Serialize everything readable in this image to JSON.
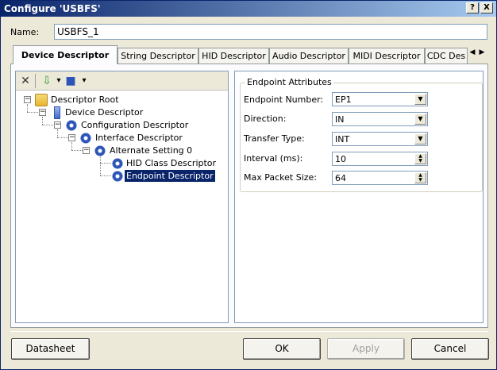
{
  "window": {
    "title": "Configure 'USBFS'",
    "help_glyph": "?",
    "close_glyph": "X"
  },
  "name_field": {
    "label": "Name:",
    "value": "USBFS_1"
  },
  "tabs": [
    {
      "label": "Device Descriptor",
      "active": true
    },
    {
      "label": "String Descriptor"
    },
    {
      "label": "HID Descriptor"
    },
    {
      "label": "Audio Descriptor"
    },
    {
      "label": "MIDI Descriptor"
    },
    {
      "label": "CDC Des"
    }
  ],
  "tab_scroll": {
    "left": "◀",
    "right": "▶"
  },
  "tree_toolbar": {
    "delete_glyph": "✕",
    "import_glyph": "⇩",
    "save_glyph": "■",
    "dropdown_glyph": "▾"
  },
  "tree": [
    {
      "label": "Descriptor Root",
      "expander": "−"
    },
    {
      "label": "Device Descriptor",
      "expander": "−"
    },
    {
      "label": "Configuration Descriptor",
      "expander": "−"
    },
    {
      "label": "Interface Descriptor",
      "expander": "−"
    },
    {
      "label": "Alternate Setting 0",
      "expander": "−"
    },
    {
      "label": "HID Class Descriptor"
    },
    {
      "label": "Endpoint Descriptor",
      "selected": true
    }
  ],
  "endpoint": {
    "group_title": "Endpoint Attributes",
    "fields": [
      {
        "label": "Endpoint Number:",
        "value": "EP1",
        "control": "combo"
      },
      {
        "label": "Direction:",
        "value": "IN",
        "control": "combo"
      },
      {
        "label": "Transfer Type:",
        "value": "INT",
        "control": "combo"
      },
      {
        "label": "Interval (ms):",
        "value": "10",
        "control": "spin"
      },
      {
        "label": "Max Packet Size:",
        "value": "64",
        "control": "spin"
      }
    ]
  },
  "buttons": {
    "datasheet": "Datasheet",
    "ok": "OK",
    "apply": "Apply",
    "cancel": "Cancel"
  },
  "colors": {
    "title_start": "#0a246a",
    "title_end": "#a6caf0",
    "selection": "#0a246a",
    "folder": "#f2c84b",
    "gear": "#2d55b8"
  }
}
